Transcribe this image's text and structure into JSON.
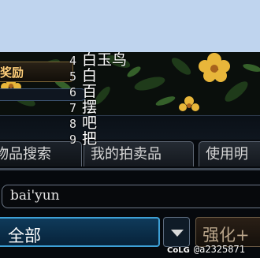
{
  "game_ui": {
    "reward_label": "奖励",
    "overlay_list": [
      {
        "number": "4",
        "text": "白玉鸟"
      },
      {
        "number": "5",
        "text": "白"
      },
      {
        "number": "6",
        "text": "百"
      },
      {
        "number": "7",
        "text": "摆"
      },
      {
        "number": "8",
        "text": "吧"
      },
      {
        "number": "9",
        "text": "把"
      }
    ],
    "tabs": [
      "物品搜索",
      "我的拍卖品",
      "使用明"
    ],
    "search_value": "bai'yun",
    "category_selected": "全部",
    "strength_button_label": "强化+",
    "watermark_brand": "CoLG",
    "watermark_handle": "@a2325871"
  },
  "colors": {
    "category_border": "#3ea0d6",
    "category_fill": "#0f3a5a",
    "flower_yellow": "#e8b63a"
  }
}
